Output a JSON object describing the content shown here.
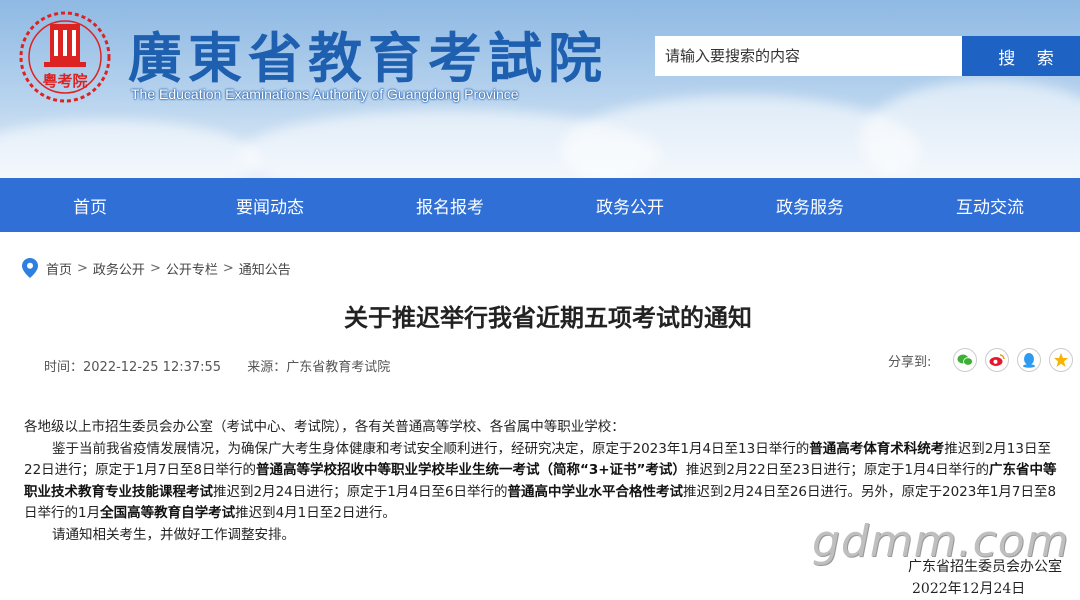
{
  "header": {
    "site_title": "廣東省教育考試院",
    "site_subtitle": "The Education Examinations Authority of Guangdong Province",
    "logo_text": "粤考院",
    "search_placeholder": "请输入要搜索的内容",
    "search_button": "搜 索"
  },
  "nav": [
    "首页",
    "要闻动态",
    "报名报考",
    "政务公开",
    "政务服务",
    "互动交流"
  ],
  "breadcrumb": [
    "首页",
    "政务公开",
    "公开专栏",
    "通知公告"
  ],
  "article": {
    "title": "关于推迟举行我省近期五项考试的通知",
    "time": "时间：2022-12-25 12:37:55",
    "source": "来源：广东省教育考试院",
    "share_label": "分享到:",
    "greeting": "各地级以上市招生委员会办公室（考试中心、考试院），各有关普通高等学校、各省属中等职业学校：",
    "p1": [
      {
        "t": "鉴于当前我省疫情发展情况，为确保广大考生身体健康和考试安全顺利进行，经研究决定，原定于2023年1月4日至13日举行的",
        "b": false
      },
      {
        "t": "普通高考体育术科统考",
        "b": true
      },
      {
        "t": "推迟到2月13日至22日进行；原定于1月7日至8日举行的",
        "b": false
      },
      {
        "t": "普通高等学校招收中等职业学校毕业生统一考试（简称“3+证书”考试）",
        "b": true
      },
      {
        "t": "推迟到2月22日至23日进行；原定于1月4日举行的",
        "b": false
      },
      {
        "t": "广东省中等职业技术教育专业技能课程考试",
        "b": true
      },
      {
        "t": "推迟到2月24日进行；原定于1月4日至6日举行的",
        "b": false
      },
      {
        "t": "普通高中学业水平合格性考试",
        "b": true
      },
      {
        "t": "推迟到2月24日至26日进行。另外，原定于2023年1月7日至8日举行的1月",
        "b": false
      },
      {
        "t": "全国高等教育自学考试",
        "b": true
      },
      {
        "t": "推迟到4月1日至2日进行。",
        "b": false
      }
    ],
    "p2": "请通知相关考生，并做好工作调整安排。",
    "signature_org": "广东省招生委员会办公室",
    "signature_date": "2022年12月24日"
  },
  "watermark": "gdmm.com",
  "colors": {
    "nav_bg": "#2f6fd6",
    "search_btn": "#1e63c4",
    "title_blue": "#1e5fb0"
  }
}
